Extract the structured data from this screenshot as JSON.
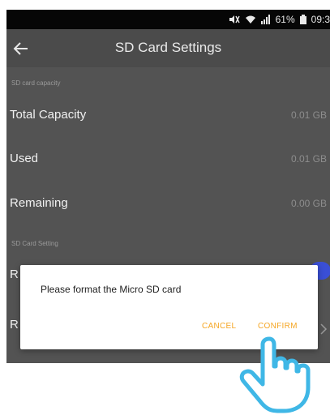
{
  "status_bar": {
    "battery": "61%",
    "time": "09:3",
    "icons": [
      "mute-icon",
      "wifi-icon",
      "signal-icon",
      "battery-icon"
    ]
  },
  "app_bar": {
    "title": "SD Card Settings",
    "back_icon": "back-arrow-icon"
  },
  "capacity_section": {
    "header": "SD card capacity",
    "rows": [
      {
        "label": "Total Capacity",
        "value": "0.01 GB"
      },
      {
        "label": "Used",
        "value": "0.01 GB"
      },
      {
        "label": "Remaining",
        "value": "0.00 GB"
      }
    ]
  },
  "setting_section": {
    "header": "SD Card Setting",
    "row1_label_visible": "R",
    "row1_toggle_on": true,
    "row2_label_visible": "R"
  },
  "dialog": {
    "message": "Please format the Micro SD card",
    "cancel_label": "CANCEL",
    "confirm_label": "CONFIRM"
  },
  "colors": {
    "accent": "#f5a623",
    "toggle": "#3a4fd6",
    "background": "#535353"
  }
}
